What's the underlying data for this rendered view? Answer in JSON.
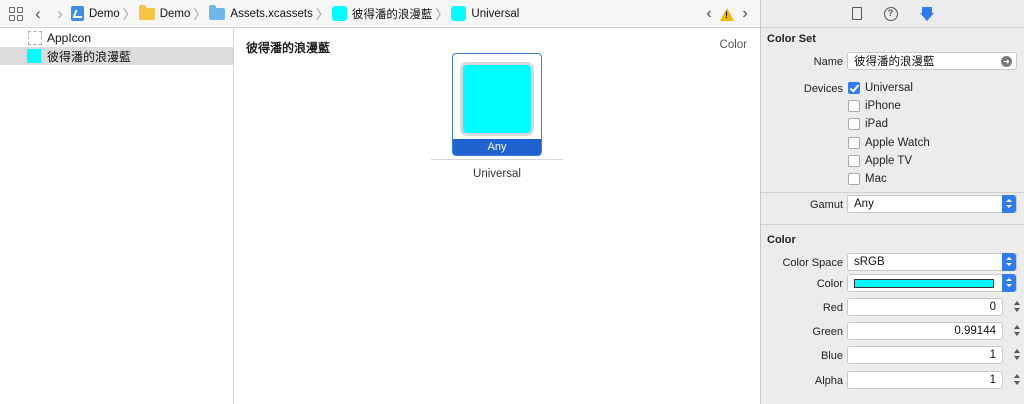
{
  "breadcrumb": {
    "items": [
      "Demo",
      "Demo",
      "Assets.xcassets",
      "彼得潘的浪漫藍",
      "Universal"
    ]
  },
  "sidebar": {
    "items": [
      {
        "label": "AppIcon"
      },
      {
        "label": "彼得潘的浪漫藍"
      }
    ]
  },
  "canvas": {
    "title": "彼得潘的浪漫藍",
    "type_label": "Color",
    "slot_label": "Any",
    "slot_caption": "Universal"
  },
  "inspector": {
    "color_set": {
      "heading": "Color Set",
      "name_label": "Name",
      "name_value": "彼得潘的浪漫藍",
      "devices_label": "Devices",
      "devices": [
        {
          "label": "Universal",
          "checked": true
        },
        {
          "label": "iPhone",
          "checked": false
        },
        {
          "label": "iPad",
          "checked": false
        },
        {
          "label": "Apple Watch",
          "checked": false
        },
        {
          "label": "Apple TV",
          "checked": false
        },
        {
          "label": "Mac",
          "checked": false
        }
      ],
      "gamut_label": "Gamut",
      "gamut_value": "Any"
    },
    "color": {
      "heading": "Color",
      "space_label": "Color Space",
      "space_value": "sRGB",
      "color_label": "Color",
      "swatch_color": "#00fdff",
      "red_label": "Red",
      "red_value": "0",
      "green_label": "Green",
      "green_value": "0.99144",
      "blue_label": "Blue",
      "blue_value": "1",
      "alpha_label": "Alpha",
      "alpha_value": "1"
    }
  },
  "colors": {
    "accent": "#2f7bf0",
    "swatch": "#00fdff"
  }
}
